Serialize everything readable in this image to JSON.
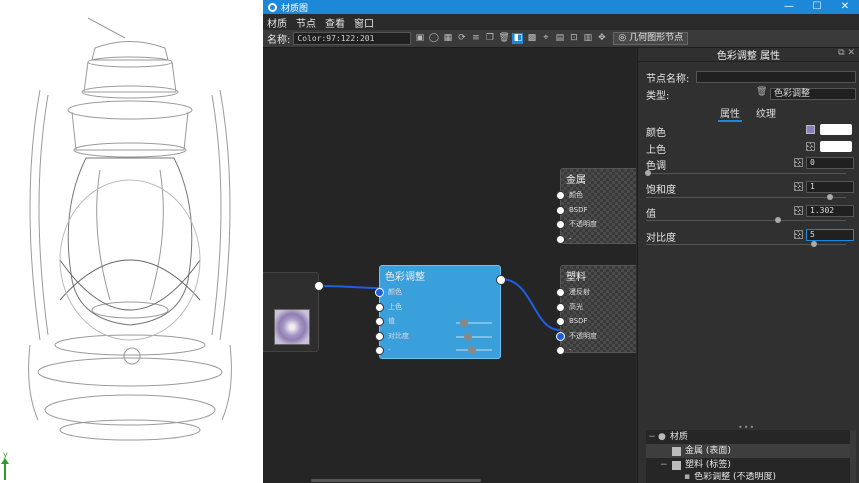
{
  "window": {
    "title": "材质图",
    "controls": [
      "—",
      "☐",
      "✕"
    ]
  },
  "menu": [
    "材质",
    "节点",
    "查看",
    "窗口"
  ],
  "toolbar": {
    "name_label": "名称:",
    "name_value": "Color:97:122:201",
    "geometry_node_label": "几何图形节点"
  },
  "graph": {
    "node_metal": {
      "title": "金属",
      "ports": [
        "颜色",
        "BSDF",
        "不透明度",
        "-"
      ]
    },
    "node_plastic": {
      "title": "塑料",
      "ports": [
        "漫反射",
        "高光",
        "BSDF",
        "不透明度",
        "-"
      ]
    },
    "node_color_adjust": {
      "title": "色彩调整",
      "ports": [
        "颜色",
        "上色",
        "值",
        "对比度",
        "-"
      ]
    }
  },
  "panel": {
    "title": "色彩调整 属性",
    "node_name_label": "节点名称:",
    "node_name_value": "",
    "type_label": "类型:",
    "type_value": "色彩调整",
    "tabs": [
      "属性",
      "纹理"
    ],
    "props": {
      "color_label": "颜色",
      "tint_label": "上色",
      "hue_label": "色调",
      "hue_value": "0",
      "saturation_label": "饱和度",
      "saturation_value": "1",
      "value_label": "值",
      "value_value": "1.302",
      "contrast_label": "对比度",
      "contrast_value": "5"
    },
    "tree": [
      "材质",
      "金属 (表面)",
      "塑料 (标签)",
      "色彩调整 (不透明度)"
    ]
  },
  "viewport": {
    "axis_label": "y"
  }
}
